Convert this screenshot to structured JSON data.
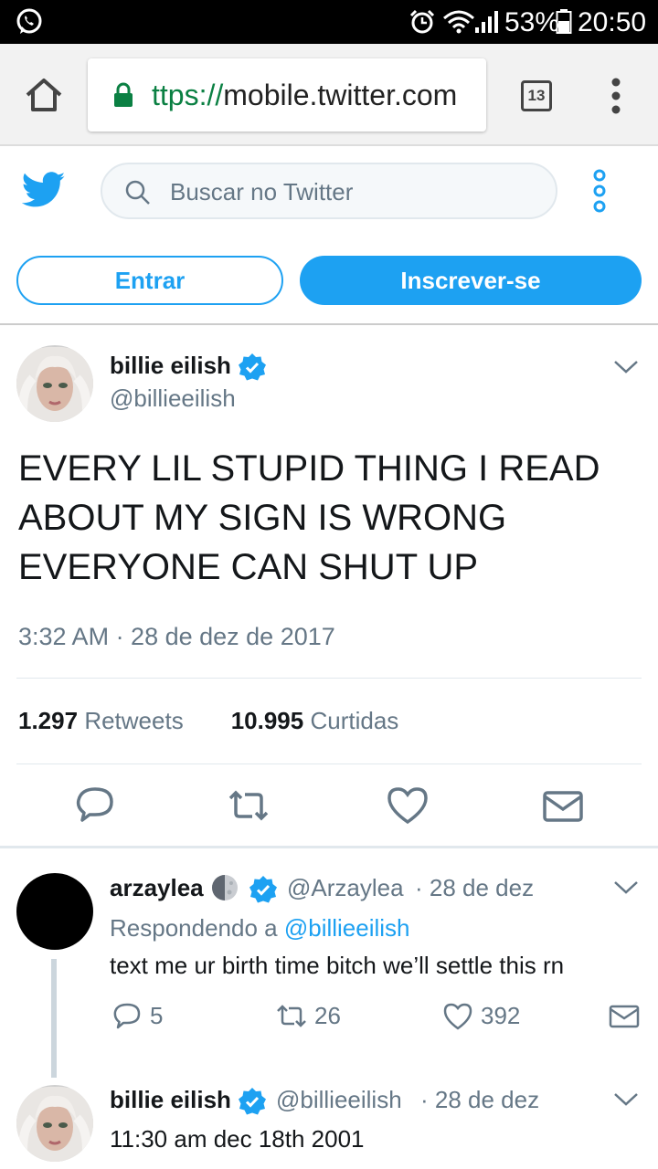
{
  "status_bar": {
    "battery": "53%",
    "time": "20:50"
  },
  "browser": {
    "url_scheme": "ttps://",
    "url_host": "mobile.twitter.com",
    "tab_count": "13"
  },
  "header": {
    "search_placeholder": "Buscar no Twitter",
    "login_label": "Entrar",
    "signup_label": "Inscrever-se"
  },
  "tweet": {
    "author_name": "billie eilish",
    "author_handle": "@billieeilish",
    "text": "EVERY LIL STUPID THING I READ ABOUT MY SIGN IS WRONG EVERYONE CAN SHUT UP",
    "timestamp": "3:32 AM · 28 de dez de 2017",
    "retweets_count": "1.297",
    "retweets_label": "Retweets",
    "likes_count": "10.995",
    "likes_label": "Curtidas"
  },
  "reply": {
    "author_name": "arzaylea",
    "author_handle": "@Arzaylea",
    "date": "· 28 de dez",
    "replying_prefix": "Respondendo a",
    "replying_to": "@billieeilish",
    "text": "text me ur birth time bitch we’ll settle this rn",
    "replies": "5",
    "retweets": "26",
    "likes": "392"
  },
  "reply2": {
    "author_name": "billie eilish",
    "author_handle": "@billieeilish",
    "date": "· 28 de dez",
    "text": "11:30 am dec 18th 2001"
  },
  "colors": {
    "accent": "#1da1f2",
    "muted": "#657786",
    "text": "#14171a",
    "secure": "#0b8043"
  }
}
